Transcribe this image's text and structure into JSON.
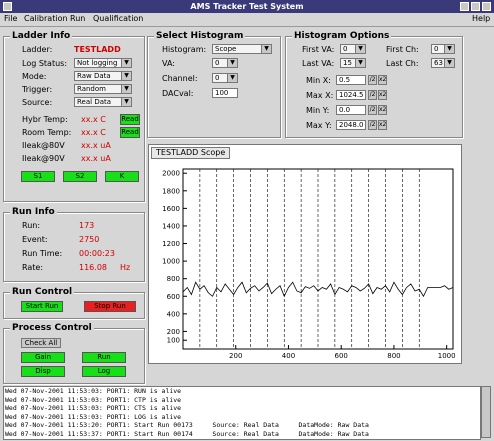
{
  "window": {
    "title": "AMS Tracker Test System"
  },
  "menu": {
    "items": [
      "File",
      "Calibration",
      "Run",
      "Qualification"
    ],
    "help": "Help"
  },
  "ladder_info": {
    "legend": "Ladder Info",
    "ladder_label": "Ladder:",
    "ladder_value": "TESTLADD",
    "log_status_label": "Log Status:",
    "log_status_value": "Not logging",
    "mode_label": "Mode:",
    "mode_value": "Raw Data",
    "trigger_label": "Trigger:",
    "trigger_value": "Random",
    "source_label": "Source:",
    "source_value": "Real Data",
    "hybr_temp_label": "Hybr Temp:",
    "hybr_temp_value": "xx.x C",
    "hybr_read": "Read",
    "room_temp_label": "Room Temp:",
    "room_temp_value": "xx.x C",
    "room_read": "Read",
    "ileak80_label": "Ileak@80V",
    "ileak80_value": "xx.x uA",
    "ileak90_label": "Ileak@90V",
    "ileak90_value": "xx.x uA",
    "buttons": [
      "S1",
      "S2",
      "K"
    ]
  },
  "select_histogram": {
    "legend": "Select Histogram",
    "histogram_label": "Histogram:",
    "histogram_value": "Scope",
    "va_label": "VA:",
    "va_value": "0",
    "channel_label": "Channel:",
    "channel_value": "0",
    "dacval_label": "DACval:",
    "dacval_value": "100"
  },
  "histogram_options": {
    "legend": "Histogram Options",
    "first_va_label": "First VA:",
    "first_va_value": "0",
    "last_va_label": "Last VA:",
    "last_va_value": "15",
    "first_ch_label": "First Ch:",
    "first_ch_value": "0",
    "last_ch_label": "Last Ch:",
    "last_ch_value": "63",
    "min_x_label": "Min X:",
    "min_x_value": "0.5",
    "max_x_label": "Max X:",
    "max_x_value": "1024.5",
    "min_y_label": "Min Y:",
    "min_y_value": "0.0",
    "max_y_label": "Max Y:",
    "max_y_value": "2048.0"
  },
  "run_info": {
    "legend": "Run Info",
    "run_label": "Run:",
    "run_value": "173",
    "event_label": "Event:",
    "event_value": "2750",
    "run_time_label": "Run Time:",
    "run_time_value": "00:00:23",
    "rate_label": "Rate:",
    "rate_value": "116.08",
    "rate_unit": "Hz"
  },
  "run_control": {
    "legend": "Run Control",
    "start": "Start Run",
    "stop": "Stop Run"
  },
  "process_control": {
    "legend": "Process Control",
    "check_all": "Check All",
    "buttons": [
      "Gain",
      "Run",
      "Disp",
      "Log"
    ]
  },
  "scope_tab": "TESTLADD Scope",
  "log": [
    "Wed 07-Nov-2001 11:53:03: PORT1: RUN is alive",
    "Wed 07-Nov-2001 11:53:03: PORT1: CTP is alive",
    "Wed 07-Nov-2001 11:53:03: PORT1: CTS is alive",
    "Wed 07-Nov-2001 11:53:03: PORT1: LOG is alive",
    "Wed 07-Nov-2001 11:53:20: PORT1: Start Run 00173     Source: Real Data     DataMode: Raw Data",
    "Wed 07-Nov-2001 11:53:37: PORT1: Start Run 00174     Source: Real Data     DataMode: Raw Data"
  ],
  "chart_data": {
    "type": "line",
    "title": "",
    "xlabel": "",
    "ylabel": "",
    "xlim": [
      0,
      1024
    ],
    "ylim": [
      0,
      2048
    ],
    "x_ticks": [
      200,
      400,
      600,
      800,
      1000
    ],
    "y_ticks": [
      100,
      200,
      400,
      600,
      800,
      1000,
      1200,
      1400,
      1600,
      1800,
      2000
    ],
    "grid": false,
    "va_dividers": [
      64,
      128,
      192,
      256,
      320,
      384,
      448,
      512,
      576,
      640,
      704,
      768,
      832,
      896
    ],
    "series": [
      {
        "x": [
          0,
          16,
          32,
          48,
          64,
          80,
          96,
          112,
          128,
          144,
          160,
          176,
          192,
          208,
          224,
          240,
          256,
          272,
          288,
          304,
          320,
          336,
          352,
          368,
          384,
          400,
          416,
          432,
          448,
          464,
          480,
          496,
          512,
          528,
          544,
          560,
          576,
          592,
          608,
          624,
          640,
          656,
          672,
          688,
          704,
          720,
          736,
          752,
          768,
          784,
          800,
          816,
          832,
          848,
          864,
          880,
          896,
          912,
          928,
          944,
          960,
          976,
          992,
          1008,
          1024
        ],
        "values": [
          650,
          700,
          620,
          760,
          680,
          720,
          640,
          600,
          700,
          650,
          740,
          680,
          620,
          700,
          760,
          640,
          690,
          720,
          660,
          700,
          750,
          630,
          680,
          720,
          600,
          700,
          760,
          660,
          640,
          710,
          690,
          720,
          660,
          700,
          680,
          740,
          620,
          700,
          680,
          650,
          720,
          700,
          660,
          690,
          740,
          630,
          700,
          680,
          720,
          650,
          760,
          680,
          620,
          700,
          740,
          660,
          680,
          600,
          700,
          700,
          700,
          700,
          720,
          680,
          700
        ]
      }
    ]
  }
}
